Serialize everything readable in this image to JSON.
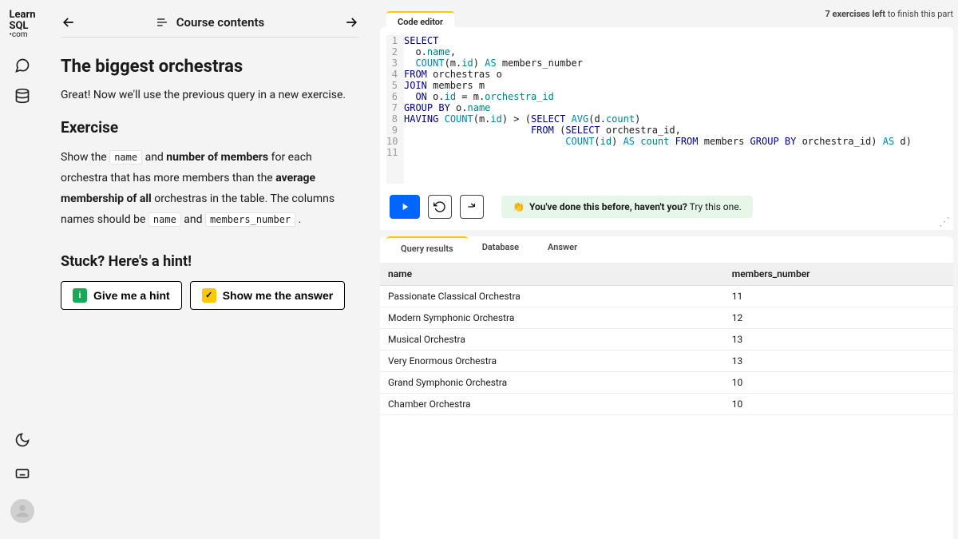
{
  "logo": {
    "l1": "Learn",
    "l2": "SQL",
    "sub": "•com"
  },
  "nav": {
    "title": "Course contents"
  },
  "topbar": {
    "bold": "7 exercises left",
    "rest": " to finish this part"
  },
  "page": {
    "title": "The biggest orchestras",
    "intro": "Great! Now we'll use the previous query in a new exercise.",
    "exercise_h": "Exercise",
    "ex": {
      "p1a": "Show the ",
      "c1": "name",
      "p1b": " and ",
      "b1": "number of members",
      "p1c": " for each orchestra that has more members than the ",
      "b2": "average membership of all",
      "p2": " orchestras in the table. The columns names should be ",
      "c2": "name",
      "p3": " and ",
      "c3": "members_number",
      "p4": " ."
    },
    "hint_h": "Stuck? Here's a hint!",
    "hint_btn": "Give me a hint",
    "ans_btn": "Show me the answer"
  },
  "editor": {
    "tab": "Code editor",
    "gutter": [
      "1",
      "2",
      "3",
      "4",
      "5",
      "6",
      "7",
      "8",
      "9",
      "10",
      "11"
    ]
  },
  "feedback": {
    "emoji": "👏",
    "bold": "You've done this before, haven't you?",
    "rest": " Try this one."
  },
  "results": {
    "tabs": [
      "Query results",
      "Database",
      "Answer"
    ],
    "cols": [
      "name",
      "members_number"
    ],
    "rows": [
      [
        "Passionate Classical Orchestra",
        "11"
      ],
      [
        "Modern Symphonic Orchestra",
        "12"
      ],
      [
        "Musical Orchestra",
        "13"
      ],
      [
        "Very Enormous Orchestra",
        "13"
      ],
      [
        "Grand Symphonic Orchestra",
        "10"
      ],
      [
        "Chamber Orchestra",
        "10"
      ]
    ]
  },
  "chart_data": {
    "type": "table",
    "title": "Query results",
    "columns": [
      "name",
      "members_number"
    ],
    "rows": [
      [
        "Passionate Classical Orchestra",
        11
      ],
      [
        "Modern Symphonic Orchestra",
        12
      ],
      [
        "Musical Orchestra",
        13
      ],
      [
        "Very Enormous Orchestra",
        13
      ],
      [
        "Grand Symphonic Orchestra",
        10
      ],
      [
        "Chamber Orchestra",
        10
      ]
    ]
  }
}
